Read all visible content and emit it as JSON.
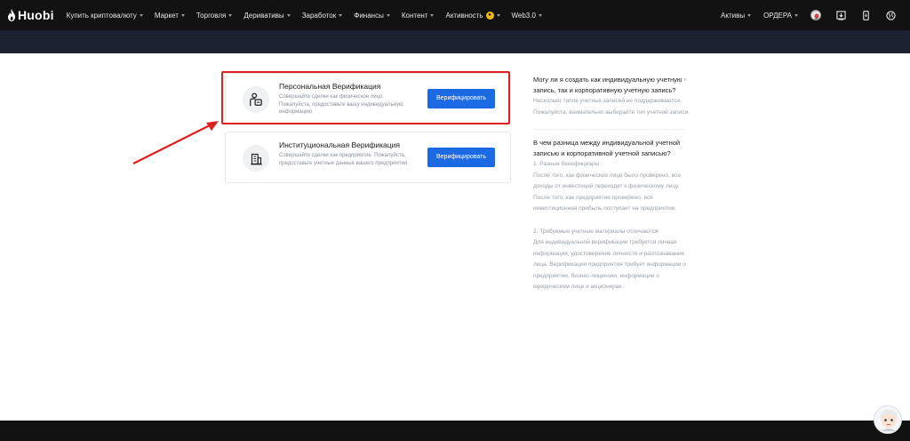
{
  "nav": {
    "logo": "Huobi",
    "items": [
      {
        "label": "Купить криптовалюту",
        "caret": true
      },
      {
        "label": "Маркет",
        "caret": true
      },
      {
        "label": "Торговля",
        "caret": true
      },
      {
        "label": "Деривативы",
        "caret": true
      },
      {
        "label": "Заработок",
        "caret": true
      },
      {
        "label": "Финансы",
        "caret": true
      },
      {
        "label": "Контент",
        "caret": true
      },
      {
        "label": "Активность",
        "caret": true,
        "badge": true
      },
      {
        "label": "Web3.0",
        "caret": true
      }
    ],
    "right": {
      "assets": "Активы",
      "orders": "ОРДЕРА"
    },
    "icons": [
      "avatar",
      "download-icon",
      "mobile-icon",
      "globe-icon"
    ]
  },
  "cards": {
    "personal": {
      "title": "Персональная Верификация",
      "desc": "Совершайте сделки как физическое лицо. Пожалуйста, предоставьте вашу индивидуальную информацию",
      "button": "Верифицировать",
      "icon": "person-id-icon"
    },
    "institutional": {
      "title": "Институциональная Верификация",
      "desc": "Совершайте сделки как предприятие. Пожалуйста, предоставьте учетные данные вашего предприятия",
      "button": "Верифицировать",
      "icon": "building-icon"
    }
  },
  "faq": {
    "q1": "Могу ли я создать как индивидуальную учетную запись, так и корпоративную учетную запись?",
    "a1": "Несколько типов учетных записей не поддерживаются. Пожалуйста, внимательно выбирайте тип учетной записи.",
    "close": "×",
    "q2": "В чем разница между индивидуальной учетной записью и корпоративной учетной записью?",
    "a2_p1": "1. Разные бенефициары\nПосле того, как физическое лицо было проверено, все доходы от инвестиций переходят к физическому лицу. После того, как предприятие проверено, вся инвестиционная прибыль поступает на предприятие.",
    "a2_p2": "2. Требуемые учетные материалы отличаются\nДля индивидуальной верификации требуется личная информация, удостоверение личности и распознавание лица. Верификация предприятия требует информации о предприятии, бизнес-лицензии, информации о юридическом лице и акционерах."
  },
  "colors": {
    "accent": "#1b6ae4",
    "highlight": "#e02020",
    "nav_bg": "#121212",
    "subbar_bg": "#1b2130"
  }
}
